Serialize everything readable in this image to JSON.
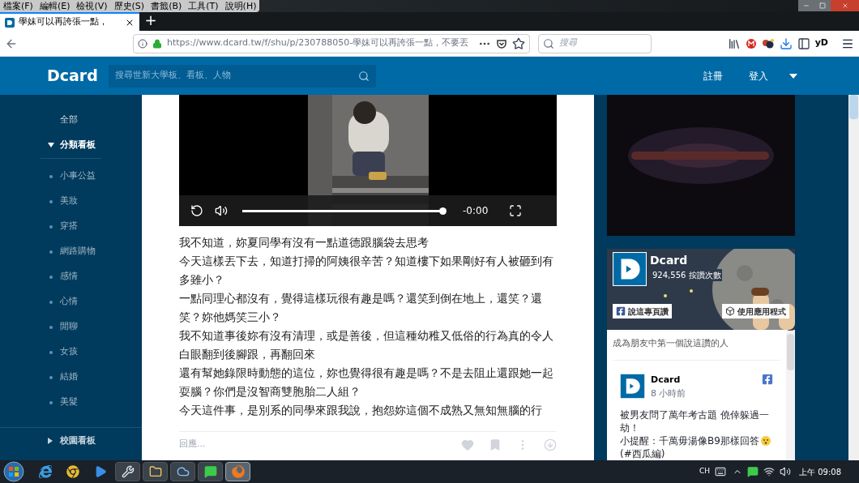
{
  "menu_bar": [
    "檔案(F)",
    "編輯(E)",
    "檢視(V)",
    "歷史(S)",
    "書籤(B)",
    "工具(T)",
    "說明(H)"
  ],
  "tabs": [
    {
      "title": "學妹可以再誇張一點，",
      "selected": true
    }
  ],
  "new_tab": "+",
  "address_bar": {
    "url": "https://www.dcard.tw/f/shu/p/230788050-學妹可以再誇張一點，不要丟"
  },
  "browser_search": {
    "placeholder": "搜尋"
  },
  "extension_badge": "yD",
  "site_header": {
    "logo": "Dcard",
    "search": {
      "placeholder": "搜尋世新大學板、看板、人物"
    },
    "links": [
      "註冊",
      "登入"
    ]
  },
  "sidebar": {
    "items": [
      {
        "label": "全部",
        "kind": "link"
      },
      {
        "label": "分類看板",
        "kind": "section",
        "expanded": true,
        "children": [
          {
            "label": "小事公益"
          },
          {
            "label": "美妝"
          },
          {
            "label": "穿搭"
          },
          {
            "label": "網路購物"
          },
          {
            "label": "感情"
          },
          {
            "label": "心情"
          },
          {
            "label": "閒聊"
          },
          {
            "label": "女孩"
          },
          {
            "label": "結婚"
          },
          {
            "label": "美髮"
          }
        ]
      },
      {
        "label": "校園看板",
        "kind": "section",
        "expanded": false
      }
    ]
  },
  "video": {
    "time": "-0:00",
    "progress": {
      "level": 1
    }
  },
  "post": {
    "paragraphs": [
      "我不知道，妳夏同學有沒有一點道德跟腦袋去思考",
      "今天這樣丟下去，知道打掃的阿姨很辛苦？知道樓下如果剛好有人被砸到有多雖小？",
      "一點同理心都沒有，覺得這樣玩很有趣是嗎？還笑到倒在地上，還笑？還笑？妳他媽笑三小？",
      "我不知道事後妳有沒有清理，或是善後，但這種幼稚又低俗的行為真的令人白眼翻到後腳跟，再翻回來",
      "還有幫她錄限時動態的這位，妳也覺得很有趣是嗎？不是去阻止還跟她一起耍腦？你們是沒智商雙胞胎二人組？",
      "今天這件事，是別系的同學來跟我說，抱怨妳這個不成熟又無知無腦的行"
    ],
    "reply": {
      "placeholder": "回應..."
    }
  },
  "facebook_widget": {
    "page_name": "Dcard",
    "likes": "924,556 按讚次數",
    "buttons": [
      "說這專頁讚",
      "使用應用程式"
    ],
    "friends_note": "成為朋友中第一個說這讚的人",
    "feed_post": {
      "author": "Dcard",
      "time": "8 小時前",
      "lines": [
        "被男友問了萬年考古題 僥倖躲過一劫！",
        "小提醒：千萬毋湯像B9那樣回答",
        "(#西瓜編)"
      ]
    }
  },
  "taskbar": {
    "apps": [
      {
        "kind": "ie",
        "selected": false
      },
      {
        "kind": "chrome",
        "selected": false
      },
      {
        "kind": "media",
        "selected": false
      },
      {
        "kind": "tool",
        "selected": false
      },
      {
        "kind": "folder",
        "selected": false
      },
      {
        "kind": "cloud",
        "selected": false
      },
      {
        "kind": "chat",
        "selected": false
      },
      {
        "kind": "firefox",
        "selected": true
      }
    ],
    "language": "CH",
    "clock": "上午 09:08"
  }
}
